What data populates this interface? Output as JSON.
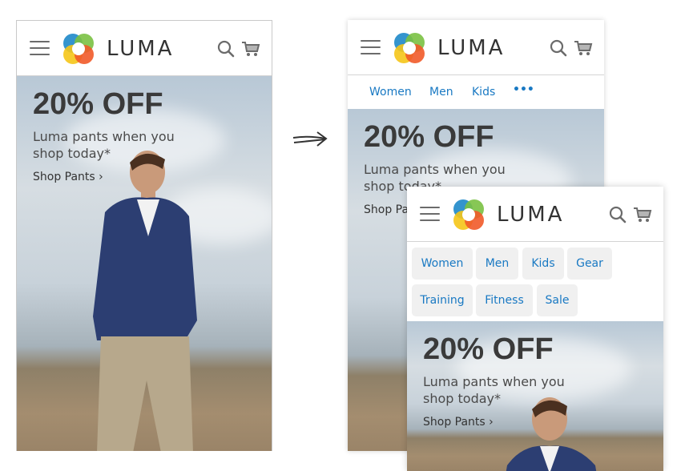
{
  "brand": {
    "name": "LUMA"
  },
  "promo": {
    "headline": "20% OFF",
    "subline": "Luma pants when you shop today*",
    "cta": "Shop Pants",
    "cta_chevron": "›"
  },
  "nav_collapsed": {
    "items": [
      "Women",
      "Men",
      "Kids"
    ],
    "more": "•••"
  },
  "nav_expanded": {
    "items": [
      "Women",
      "Men",
      "Kids",
      "Gear",
      "Training",
      "Fitness",
      "Sale"
    ]
  },
  "colors": {
    "link": "#1979c3",
    "pill_bg": "#f0f0f0",
    "text_dark": "#3a3a3a"
  },
  "icons": [
    "hamburger-icon",
    "luma-logo-icon",
    "search-icon",
    "cart-icon",
    "arrow-right-icon"
  ]
}
